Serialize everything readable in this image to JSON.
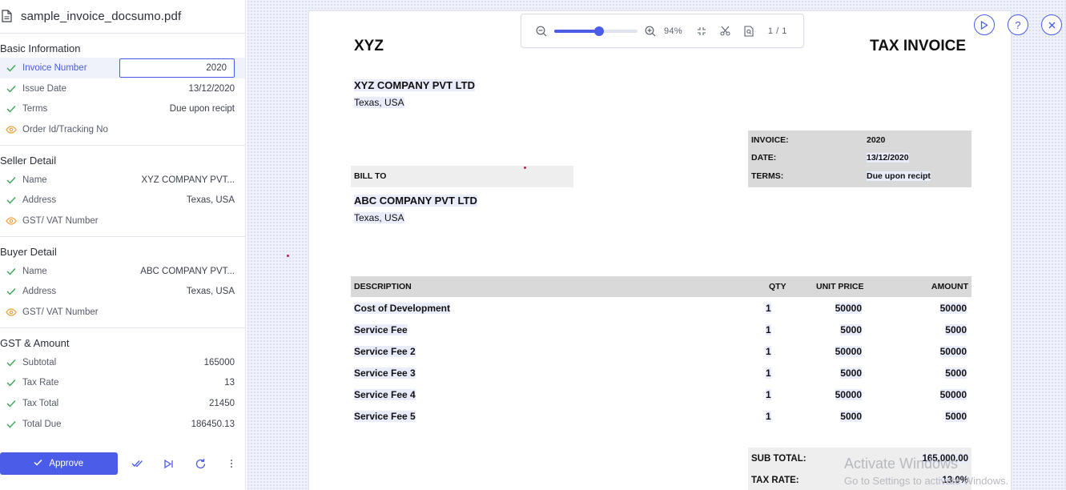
{
  "file": {
    "name": "sample_invoice_docsumo.pdf",
    "icon": "document-icon"
  },
  "sections": {
    "basic": {
      "title": "Basic Information",
      "fields": [
        {
          "label": "Invoice Number",
          "value": "2020",
          "status": "check"
        },
        {
          "label": "Issue Date",
          "value": "13/12/2020",
          "status": "check"
        },
        {
          "label": "Terms",
          "value": "Due upon recipt",
          "status": "check"
        },
        {
          "label": "Order Id/Tracking No",
          "value": "",
          "status": "eye"
        }
      ]
    },
    "seller": {
      "title": "Seller Detail",
      "fields": [
        {
          "label": "Name",
          "value": "XYZ COMPANY PVT...",
          "status": "check"
        },
        {
          "label": "Address",
          "value": "Texas, USA",
          "status": "check"
        },
        {
          "label": "GST/ VAT Number",
          "value": "",
          "status": "eye"
        }
      ]
    },
    "buyer": {
      "title": "Buyer Detail",
      "fields": [
        {
          "label": "Name",
          "value": "ABC COMPANY PVT...",
          "status": "check"
        },
        {
          "label": "Address",
          "value": "Texas, USA",
          "status": "check"
        },
        {
          "label": "GST/ VAT Number",
          "value": "",
          "status": "eye"
        }
      ]
    },
    "amount": {
      "title": "GST & Amount",
      "fields": [
        {
          "label": "Subtotal",
          "value": "165000",
          "status": "check"
        },
        {
          "label": "Tax Rate",
          "value": "13",
          "status": "check"
        },
        {
          "label": "Tax Total",
          "value": "21450",
          "status": "check"
        },
        {
          "label": "Total Due",
          "value": "186450.13",
          "status": "check"
        }
      ]
    }
  },
  "actions": {
    "approve_label": "Approve"
  },
  "toolbar": {
    "zoom": "94%",
    "zoom_fraction": 0.54,
    "page": "1 / 1"
  },
  "invoice": {
    "company_short": "XYZ",
    "doc_title": "TAX INVOICE",
    "seller_name": "XYZ COMPANY PVT LTD",
    "seller_address": "Texas, USA",
    "meta": [
      {
        "key": "INVOICE:",
        "value": "2020"
      },
      {
        "key": "DATE:",
        "value": "13/12/2020"
      },
      {
        "key": "TERMS:",
        "value": "Due upon recipt"
      }
    ],
    "bill_to_label": "BILL TO",
    "buyer_name": "ABC COMPANY PVT LTD",
    "buyer_address": "Texas, USA",
    "table": {
      "headers": [
        "DESCRIPTION",
        "QTY",
        "UNIT PRICE",
        "AMOUNT"
      ],
      "rows": [
        [
          "Cost of Development",
          "1",
          "50000",
          "50000"
        ],
        [
          "Service Fee",
          "1",
          "5000",
          "5000"
        ],
        [
          "Service Fee 2",
          "1",
          "50000",
          "50000"
        ],
        [
          "Service Fee 3",
          "1",
          "5000",
          "5000"
        ],
        [
          "Service Fee 4",
          "1",
          "50000",
          "50000"
        ],
        [
          "Service Fee 5",
          "1",
          "5000",
          "5000"
        ]
      ]
    },
    "totals": [
      {
        "key": "SUB TOTAL:",
        "value": "165,000.00"
      },
      {
        "key": "TAX RATE:",
        "value": "13.0%"
      }
    ]
  },
  "watermark": {
    "line1": "Activate Windows",
    "line2": "Go to Settings to activate Windows."
  },
  "colors": {
    "accent": "#4a5ce8",
    "check": "#3aa757",
    "eye": "#e8a33d"
  }
}
